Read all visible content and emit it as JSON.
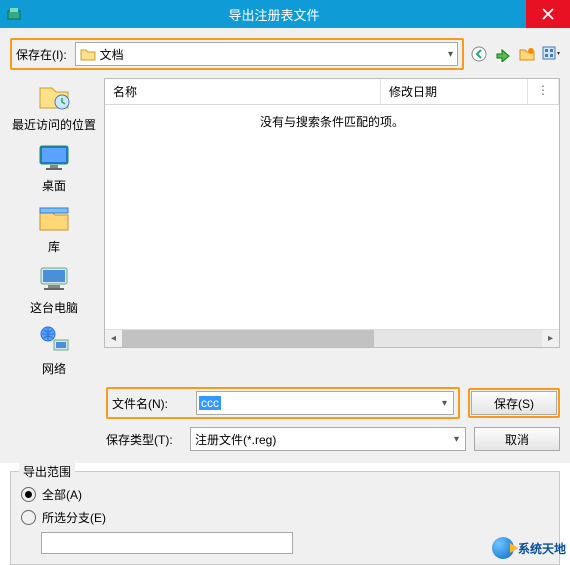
{
  "titlebar": {
    "title": "导出注册表文件"
  },
  "save_in": {
    "label": "保存在(I):",
    "value": "文档"
  },
  "columns": {
    "name": "名称",
    "date": "修改日期"
  },
  "empty_text": "没有与搜索条件匹配的项。",
  "sidebar": {
    "recent": "最近访问的位置",
    "desktop": "桌面",
    "libraries": "库",
    "computer": "这台电脑",
    "network": "网络"
  },
  "form": {
    "filename_label": "文件名(N):",
    "filename_value": "ccc",
    "filetype_label": "保存类型(T):",
    "filetype_value": "注册文件(*.reg)",
    "save_btn": "保存(S)",
    "cancel_btn": "取消"
  },
  "export_range": {
    "legend": "导出范围",
    "all": "全部(A)",
    "selected": "所选分支(E)"
  },
  "footer": "系统天地"
}
